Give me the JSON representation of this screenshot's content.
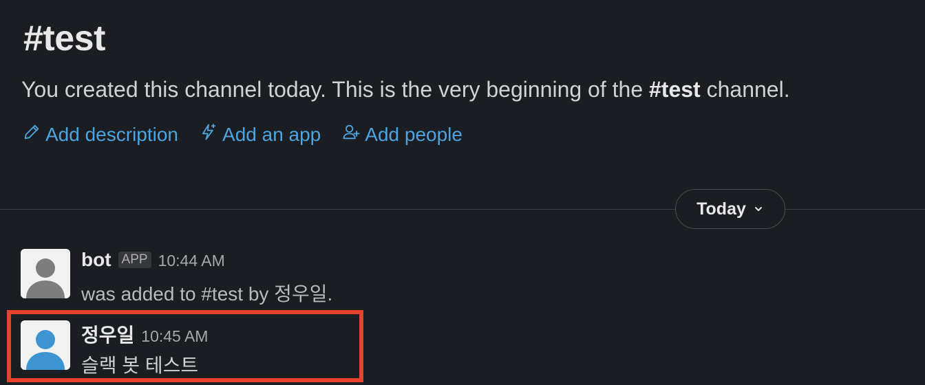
{
  "channel": {
    "title": "#test",
    "intro_prefix": "You created this channel today. This is the very beginning of the ",
    "intro_channel": "#test",
    "intro_suffix": " channel."
  },
  "actions": [
    {
      "label": "Add description",
      "icon": "pencil-icon"
    },
    {
      "label": "Add an app",
      "icon": "lightning-icon"
    },
    {
      "label": "Add people",
      "icon": "add-person-icon"
    }
  ],
  "date_divider": {
    "label": "Today",
    "icon": "chevron-down-icon"
  },
  "messages": [
    {
      "sender": "bot",
      "badge": "APP",
      "time": "10:44 AM",
      "text": "was added to #test by 정우일.",
      "avatar_color": "#7d7d7d",
      "avatar_bg": "#f2f2f2"
    },
    {
      "sender": "정우일",
      "time": "10:45 AM",
      "text": "슬랙 봇 테스트",
      "avatar_color": "#3e94d1",
      "avatar_bg": "#f2f2f2"
    }
  ],
  "colors": {
    "background": "#1a1d21",
    "link": "#4ea4e0",
    "highlight": "#e8422c"
  }
}
